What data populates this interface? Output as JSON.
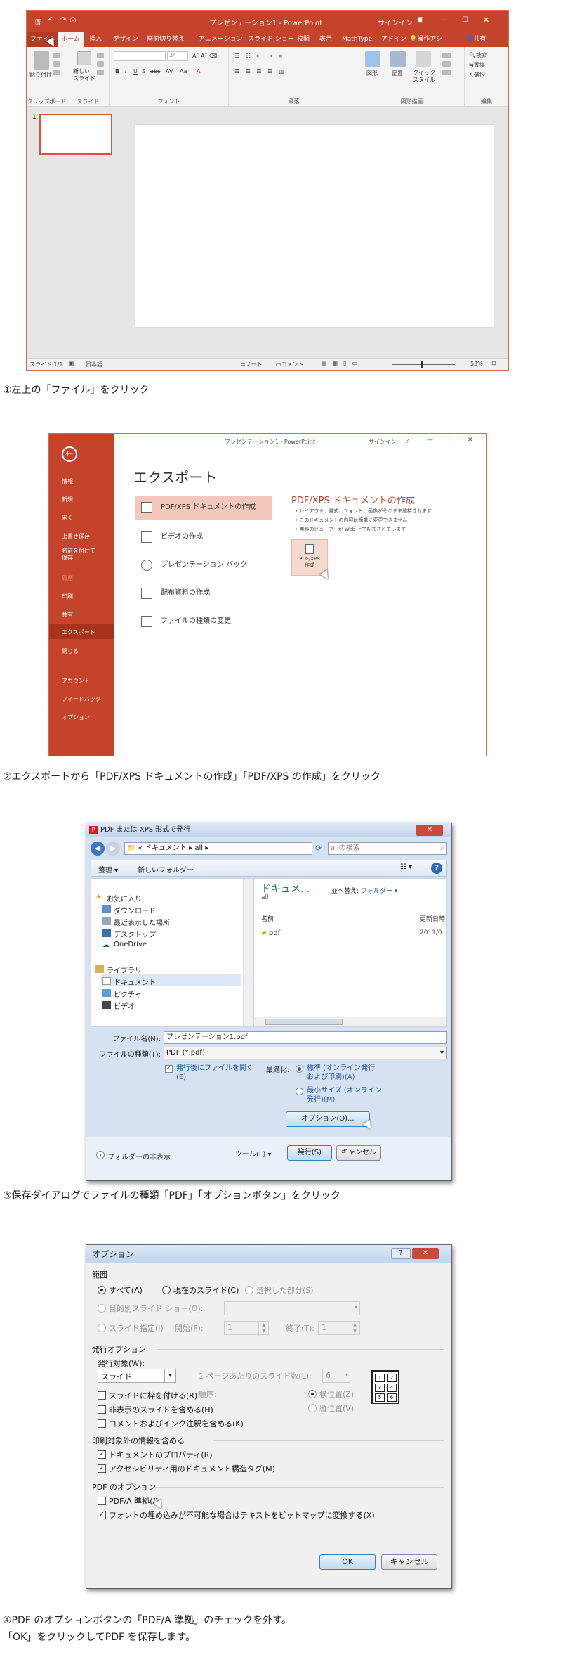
{
  "ppt": {
    "title": "プレゼンテーション1 - PowerPoint",
    "signin": "サインイン",
    "tabs": [
      "ファイル",
      "ホーム",
      "挿入",
      "デザイン",
      "画面切り替え",
      "アニメーション",
      "スライド ショー",
      "校閲",
      "表示",
      "MathType",
      "アドイン"
    ],
    "help": "操作アシ",
    "share": "共有",
    "ribbon": {
      "paste": "貼り付け",
      "new_slide": "新しい\nスライド",
      "font_size": "24",
      "groups": [
        "クリップボード",
        "スライド",
        "フォント",
        "段落",
        "図形描画",
        "編集"
      ],
      "shape": "図形",
      "arrange": "配置",
      "quick_style": "クイック\nスタイル",
      "search": "検索",
      "replace": "置換",
      "select": "選択"
    },
    "thumb_num": "1",
    "status": {
      "slide": "スライド 1/1",
      "lang": "日本語",
      "notes": "ノート",
      "comments": "コメント",
      "zoom": "53%"
    }
  },
  "export": {
    "title": "プレゼンテーション1 - PowerPoint",
    "signin": "サインイン",
    "help": "?",
    "heading": "エクスポート",
    "sidebar": [
      "情報",
      "新規",
      "開く",
      "上書き保存",
      "名前を付けて\n保存",
      "印刷",
      "共有",
      "エクスポート",
      "閉じる",
      "アカウント",
      "フィードバック",
      "オプション"
    ],
    "sidebar_dim": "履歴",
    "items": [
      "PDF/XPS ドキュメントの作成",
      "ビデオの作成",
      "プレゼンテーション パック",
      "配布資料の作成",
      "ファイルの種類の変更"
    ],
    "detail_title": "PDF/XPS ドキュメントの作成",
    "bullets": [
      "レイアウト、書式、フォント、画像がそのまま維持されます",
      "このドキュメントの内容は簡単に変更できません",
      "無料のビューアーが Web 上で配布されています"
    ],
    "btn_label": "PDF/XPS\n作成"
  },
  "save": {
    "title": "PDF または XPS 形式で発行",
    "path": [
      "ドキュメント",
      "all"
    ],
    "search_placeholder": "allの検索",
    "organize": "整理 ▾",
    "new_folder": "新しいフォルダー",
    "tree": [
      "お気に入り",
      "ダウンロード",
      "最近表示した場所",
      "デスクトップ",
      "OneDrive",
      "ライブラリ",
      "ドキュメント",
      "ピクチャ",
      "ビデオ"
    ],
    "lib_title": "ドキュメ...",
    "lib_sub": "all",
    "sort_label": "並べ替え:",
    "sort_value": "フォルダー ▾",
    "col_name": "名前",
    "col_date": "更新日時",
    "file_name": "pdf",
    "file_date": "2011/0",
    "filename_label": "ファイル名(N):",
    "filename_value": "プレゼンテーション1.pdf",
    "filetype_label": "ファイルの種類(T):",
    "filetype_value": "PDF (*.pdf)",
    "open_after": "発行後にファイルを開く\n(E)",
    "optimize_label": "最適化:",
    "opt_standard": "標準 (オンライン発行\nおよび印刷)(A)",
    "opt_min": "最小サイズ (オンライン\n発行)(M)",
    "options_btn": "オプション(O)...",
    "hide_folders": "フォルダーの非表示",
    "tools": "ツール(L)",
    "publish": "発行(S)",
    "cancel": "キャンセル"
  },
  "options": {
    "title": "オプション",
    "help": "?",
    "range": "範囲",
    "all": "すべて(A)",
    "current": "現在のスライド(C)",
    "selection": "選択した部分(S)",
    "custom": "目的別スライド ショー(O):",
    "slides": "スライド指定(I)",
    "from": "開始(F):",
    "from_val": "1",
    "to": "終了(T):",
    "to_val": "1",
    "publish_opts": "発行オプション",
    "publish_what": "発行対象(W):",
    "publish_val": "スライド",
    "per_page": "1 ページあたりのスライド数(L):",
    "per_page_val": "6",
    "order": "順序:",
    "horizontal": "横位置(Z)",
    "vertical": "縦位置(V)",
    "frame": "スライドに枠を付ける(R)",
    "hidden": "非表示のスライドを含める(H)",
    "comments": "コメントおよびインク注釈を含める(K)",
    "nonprint": "印刷対象外の情報を含める",
    "doc_props": "ドキュメントのプロパティ(R)",
    "access": "アクセシビリティ用のドキュメント構造タグ(M)",
    "pdf_opts": "PDF のオプション",
    "pdfa": "PDF/A 準拠(/)",
    "bitmap": "フォントの埋め込みが不可能な場合はテキストをビットマップに変換する(X)",
    "ok": "OK",
    "cancel": "キャンセル",
    "grid_nums": [
      "1",
      "2",
      "3",
      "4",
      "5",
      "6"
    ]
  },
  "captions": {
    "c1": "①左上の「ファイル」をクリック",
    "c2": "②エクスポートから「PDF/XPS ドキュメントの作成」「PDF/XPS の作成」をクリック",
    "c3": "③保存ダイアログでファイルの種類「PDF」「オプションボタン」をクリック",
    "c4a": "④PDF のオプションボタンの「PDF/A 準拠」のチェックを外す。",
    "c4b": "「OK」をクリックしてPDF を保存します。"
  },
  "colors": {
    "accent": "#c4432a",
    "link": "#1f57a4"
  }
}
